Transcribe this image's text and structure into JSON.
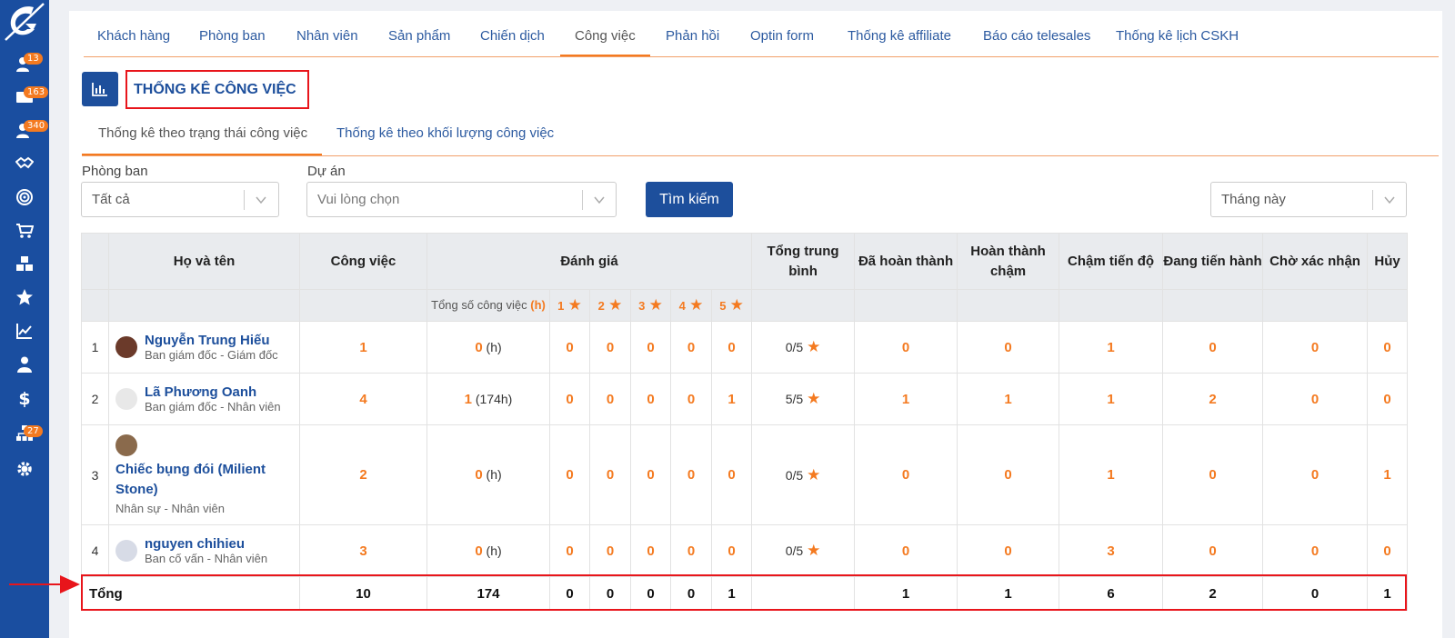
{
  "sidebar": {
    "items": [
      {
        "icon": "user-add-icon",
        "badge": "13"
      },
      {
        "icon": "mail-icon",
        "badge": "163"
      },
      {
        "icon": "users-icon",
        "badge": "340"
      },
      {
        "icon": "handshake-icon",
        "badge": ""
      },
      {
        "icon": "target-icon",
        "badge": ""
      },
      {
        "icon": "cart-icon",
        "badge": ""
      },
      {
        "icon": "boxes-icon",
        "badge": ""
      },
      {
        "icon": "star-icon",
        "badge": ""
      },
      {
        "icon": "chart-line-icon",
        "badge": ""
      },
      {
        "icon": "user-tie-icon",
        "badge": ""
      },
      {
        "icon": "dollar-icon",
        "badge": ""
      },
      {
        "icon": "sitemap-icon",
        "badge": "27"
      },
      {
        "icon": "gear-icon",
        "badge": ""
      }
    ]
  },
  "top_tabs": [
    "Khách hàng",
    "Phòng ban",
    "Nhân viên",
    "Sản phẩm",
    "Chiến dịch",
    "Công việc",
    "Phản hồi",
    "Optin form",
    "Thống kê affiliate",
    "Báo cáo telesales",
    "Thống kê lịch CSKH"
  ],
  "page_title": "THỐNG KÊ CÔNG VIỆC",
  "sub_tabs": [
    "Thống kê theo trạng thái công việc",
    "Thống kê theo khối lượng công việc"
  ],
  "filters": {
    "department_label": "Phòng ban",
    "department_value": "Tất cả",
    "project_label": "Dự án",
    "project_placeholder": "Vui lòng chọn",
    "search_label": "Tìm kiếm",
    "period_value": "Tháng này"
  },
  "table": {
    "headers": {
      "name": "Họ và tên",
      "tasks": "Công việc",
      "rating": "Đánh giá",
      "avg": "Tổng trung bình",
      "done": "Đã hoàn thành",
      "done_late": "Hoàn thành chậm",
      "behind": "Chậm tiến độ",
      "in_progress": "Đang tiến hành",
      "pending": "Chờ xác nhận",
      "cancel": "Hủy"
    },
    "subheader": {
      "total_tasks": "Tổng số công việc",
      "unit": "(h)",
      "stars": [
        "1",
        "2",
        "3",
        "4",
        "5"
      ]
    },
    "rows": [
      {
        "idx": "1",
        "name": "Nguyễn Trung Hiếu",
        "dept": "Ban giám đốc - Giám đốc",
        "tasks": "1",
        "total": "0",
        "hours": "(h)",
        "s1": "0",
        "s2": "0",
        "s3": "0",
        "s4": "0",
        "s5": "0",
        "avg": "0/5",
        "done": "0",
        "done_late": "0",
        "behind": "1",
        "in_progress": "0",
        "pending": "0",
        "cancel": "0",
        "avatar_color": "#6b3a2a"
      },
      {
        "idx": "2",
        "name": "Lã Phương Oanh",
        "dept": "Ban giám đốc - Nhân viên",
        "tasks": "4",
        "total": "1",
        "hours": "(174h)",
        "s1": "0",
        "s2": "0",
        "s3": "0",
        "s4": "0",
        "s5": "1",
        "avg": "5/5",
        "done": "1",
        "done_late": "1",
        "behind": "1",
        "in_progress": "2",
        "pending": "0",
        "cancel": "0",
        "avatar_color": "#e8e8e8"
      },
      {
        "idx": "3",
        "name": "Chiếc bụng đói (Milient Stone)",
        "dept": "Nhân sự - Nhân viên",
        "tasks": "2",
        "total": "0",
        "hours": "(h)",
        "s1": "0",
        "s2": "0",
        "s3": "0",
        "s4": "0",
        "s5": "0",
        "avg": "0/5",
        "done": "0",
        "done_late": "0",
        "behind": "1",
        "in_progress": "0",
        "pending": "0",
        "cancel": "1",
        "avatar_color": "#8a6a4c"
      },
      {
        "idx": "4",
        "name": "nguyen chihieu",
        "dept": "Ban cố vấn - Nhân viên",
        "tasks": "3",
        "total": "0",
        "hours": "(h)",
        "s1": "0",
        "s2": "0",
        "s3": "0",
        "s4": "0",
        "s5": "0",
        "avg": "0/5",
        "done": "0",
        "done_late": "0",
        "behind": "3",
        "in_progress": "0",
        "pending": "0",
        "cancel": "0",
        "avatar_color": "#d7dbe6"
      }
    ],
    "total": {
      "label": "Tổng",
      "tasks": "10",
      "total": "174",
      "s1": "0",
      "s2": "0",
      "s3": "0",
      "s4": "0",
      "s5": "1",
      "avg": "",
      "done": "1",
      "done_late": "1",
      "behind": "6",
      "in_progress": "2",
      "pending": "0",
      "cancel": "1"
    }
  },
  "colors": {
    "brand": "#1a4ea0",
    "accent": "#f47a20",
    "highlight": "#e8151b"
  }
}
